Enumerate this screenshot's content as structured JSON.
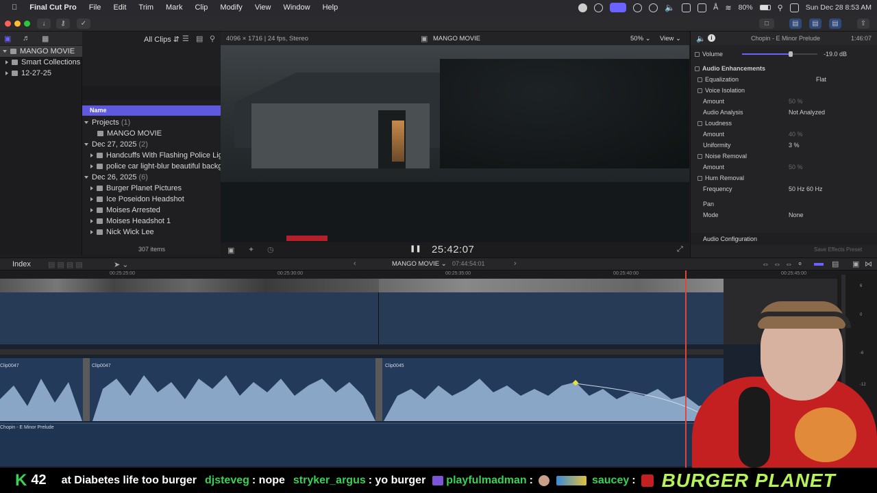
{
  "menubar": {
    "app": "Final Cut Pro",
    "items": [
      "File",
      "Edit",
      "Trim",
      "Mark",
      "Clip",
      "Modify",
      "View",
      "Window",
      "Help"
    ],
    "battery": "80%",
    "datetime": "Sun Dec 28  8:53 AM"
  },
  "library": {
    "name": "MANGO MOVIE",
    "items": [
      "Smart Collections",
      "12-27-25"
    ]
  },
  "browser": {
    "filter": "All Clips",
    "column_header": "Name",
    "groups": [
      {
        "label": "Projects",
        "count": "(1)",
        "items": [
          "MANGO MOVIE"
        ]
      },
      {
        "label": "Dec 27, 2025",
        "count": "(2)",
        "items": [
          "Handcuffs With Flashing Police Lights St",
          "police car light-blur beautiful background"
        ]
      },
      {
        "label": "Dec 26, 2025",
        "count": "(6)",
        "items": [
          "Burger Planet Pictures",
          "Ice Poseidon Headshot",
          "Moises Arrested",
          "Moises Headshot 1",
          "Nick Wick Lee"
        ]
      }
    ],
    "item_count": "307 items"
  },
  "viewer": {
    "format": "4096 × 1716 | 24 fps, Stereo",
    "project": "MANGO MOVIE",
    "zoom": "50%",
    "view_label": "View",
    "timecode": "25:42:07"
  },
  "inspector": {
    "clip_title": "Chopin - E Minor Prelude",
    "duration": "1:46:07",
    "volume_label": "Volume",
    "volume_value": "-19.0  dB",
    "section": "Audio Enhancements",
    "rows": [
      {
        "label": "Equalization",
        "value": "Flat",
        "check": true
      },
      {
        "label": "Voice Isolation",
        "value": "",
        "check": true
      },
      {
        "label": "Amount",
        "value": "50  %",
        "check": false,
        "dim": true
      },
      {
        "label": "Audio Analysis",
        "value": "Not Analyzed",
        "check": false
      },
      {
        "label": "Loudness",
        "value": "",
        "check": true
      },
      {
        "label": "Amount",
        "value": "40  %",
        "check": false,
        "dim": true
      },
      {
        "label": "Uniformity",
        "value": "3  %",
        "check": false
      },
      {
        "label": "Noise Removal",
        "value": "",
        "check": true
      },
      {
        "label": "Amount",
        "value": "50  %",
        "check": false,
        "dim": true
      },
      {
        "label": "Hum Removal",
        "value": "",
        "check": true
      },
      {
        "label": "Frequency",
        "value": "50 Hz     60 Hz",
        "check": false
      },
      {
        "label": "Pan",
        "value": "",
        "check": false
      },
      {
        "label": "Mode",
        "value": "None",
        "check": false
      }
    ],
    "audio_config": "Audio Configuration",
    "save_preset": "Save Effects Preset"
  },
  "timeline": {
    "index_label": "Index",
    "project": "MANGO MOVIE",
    "position": "07:44:54:01",
    "ruler": [
      "00:25:25:00",
      "00:25:30:00",
      "00:25:35:00",
      "00:25:40:00",
      "00:25:45:00"
    ],
    "clips": [
      "Clip0047",
      "Clip0047",
      "Clip0045"
    ],
    "music": "Chopin - E Minor Prelude",
    "meter_labels": [
      "6",
      "0",
      "-6",
      "-12"
    ]
  },
  "ticker": {
    "count": "42",
    "segments": [
      {
        "user": "",
        "msg": "at Diabetes life too burger"
      },
      {
        "user": "djsteveg",
        "msg": ": nope"
      },
      {
        "user": "stryker_argus",
        "msg": ": yo burger"
      },
      {
        "user": "playfulmadman",
        "msg": ":"
      },
      {
        "user": "saucey",
        "msg": ":"
      }
    ],
    "brand": "BURGER PLANET"
  },
  "colors": {
    "accent": "#6b63ff",
    "playhead": "#e0453a",
    "ticker_green": "#39d353",
    "ticker_brand": "#b6f25a"
  }
}
